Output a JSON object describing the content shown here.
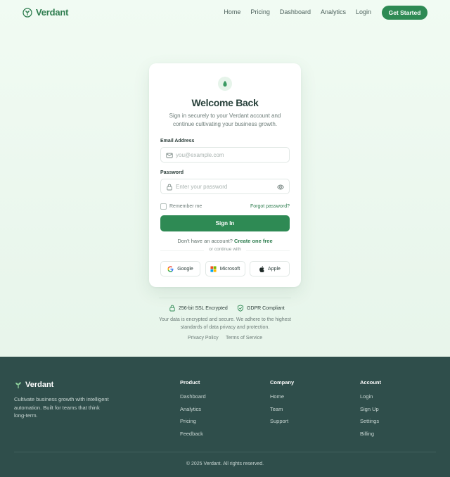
{
  "nav": {
    "brand": "Verdant",
    "links": [
      "Home",
      "Pricing",
      "Dashboard",
      "Analytics",
      "Login"
    ],
    "cta": "Get Started"
  },
  "card": {
    "icon": "leaf-icon",
    "title": "Welcome Back",
    "subtitle": "Sign in securely to your Verdant account and continue cultivating your business growth.",
    "email_label": "Email Address",
    "email_placeholder": "you@example.com",
    "email_value": "",
    "password_label": "Password",
    "password_placeholder": "Enter your password",
    "password_value": "",
    "remember_label": "Remember me",
    "remember_checked": false,
    "forgot": "Forgot password?",
    "signin": "Sign In",
    "no_account": "Don't have an account?",
    "create": "Create one free",
    "or": "or continue with",
    "social": [
      {
        "label": "Google",
        "icon": "google-icon"
      },
      {
        "label": "Microsoft",
        "icon": "microsoft-icon"
      },
      {
        "label": "Apple",
        "icon": "apple-icon"
      }
    ]
  },
  "trust": {
    "ssl": "256-bit SSL Encrypted",
    "gdpr": "GDPR Compliant",
    "text": "Your data is encrypted and secure. We adhere to the highest standards of data privacy and protection.",
    "privacy": "Privacy Policy",
    "terms": "Terms of Service"
  },
  "footer": {
    "brand": "Verdant",
    "description": "Cultivate business growth with intelligent automation. Built for teams that think long-term.",
    "columns": [
      {
        "heading": "Product",
        "links": [
          "Dashboard",
          "Analytics",
          "Pricing",
          "Feedback"
        ]
      },
      {
        "heading": "Company",
        "links": [
          "Home",
          "Team",
          "Support"
        ]
      },
      {
        "heading": "Account",
        "links": [
          "Login",
          "Sign Up",
          "Settings",
          "Billing"
        ]
      }
    ],
    "copyright": "© 2025 Verdant. All rights reserved."
  },
  "colors": {
    "primary": "#2e8a54",
    "brand_text": "#2e7d4f",
    "footer_bg": "#2f4e4b",
    "page_bg": "#edf8ef"
  }
}
